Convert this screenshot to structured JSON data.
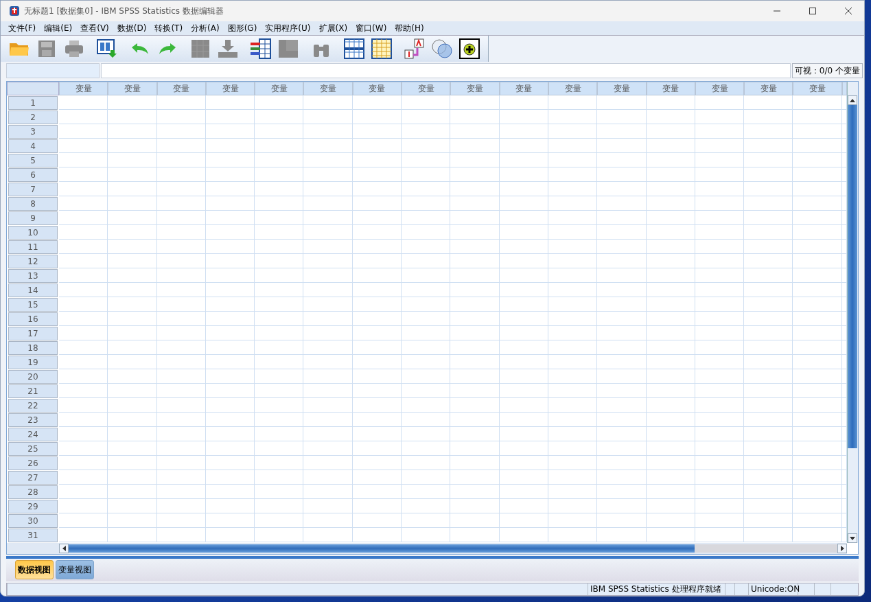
{
  "window": {
    "title": "无标题1 [数据集0] - IBM SPSS Statistics 数据编辑器"
  },
  "menu": [
    "文件(F)",
    "编辑(E)",
    "查看(V)",
    "数据(D)",
    "转换(T)",
    "分析(A)",
    "图形(G)",
    "实用程序(U)",
    "扩展(X)",
    "窗口(W)",
    "帮助(H)"
  ],
  "toolbar": [
    {
      "kind": "open",
      "disabled": false
    },
    {
      "kind": "save",
      "disabled": true
    },
    {
      "kind": "print",
      "disabled": true
    },
    {
      "kind": "dialog",
      "disabled": false
    },
    {
      "kind": "undo",
      "disabled": false
    },
    {
      "kind": "redo",
      "disabled": false
    },
    {
      "kind": "goto-case",
      "disabled": true
    },
    {
      "kind": "goto-variable",
      "disabled": true
    },
    {
      "kind": "variables",
      "disabled": false
    },
    {
      "kind": "statistics",
      "disabled": true
    },
    {
      "kind": "find",
      "disabled": true
    },
    {
      "kind": "insert-cases",
      "disabled": false
    },
    {
      "kind": "insert-variable",
      "disabled": false
    },
    {
      "kind": "value-labels",
      "disabled": false
    },
    {
      "kind": "sets",
      "disabled": false
    },
    {
      "kind": "add",
      "disabled": false
    }
  ],
  "visible_count": "可视：0/0 个变量",
  "table": {
    "columns": [
      "变量",
      "变量",
      "变量",
      "变量",
      "变量",
      "变量",
      "变量",
      "变量",
      "变量",
      "变量",
      "变量",
      "变量",
      "变量",
      "变量",
      "变量",
      "变量"
    ],
    "rows": [
      "1",
      "2",
      "3",
      "4",
      "5",
      "6",
      "7",
      "8",
      "9",
      "10",
      "11",
      "12",
      "13",
      "14",
      "15",
      "16",
      "17",
      "18",
      "19",
      "20",
      "21",
      "22",
      "23",
      "24",
      "25",
      "26",
      "27",
      "28",
      "29",
      "30",
      "31"
    ]
  },
  "tabs": [
    {
      "label": "数据视图",
      "selected": true
    },
    {
      "label": "变量视图",
      "selected": false
    }
  ],
  "status_bar": [
    "IBM SPSS Statistics 处理程序就绪",
    "Unicode:ON"
  ]
}
